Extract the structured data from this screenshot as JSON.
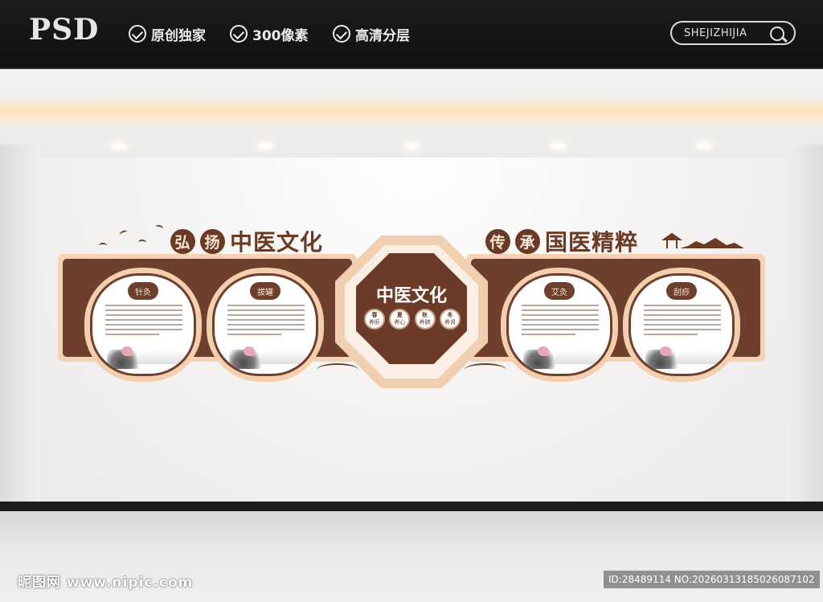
{
  "banner": {
    "logo": "PSD",
    "badges": [
      "原创独家",
      "300像素",
      "高清分层"
    ],
    "search_text": "SHEJIZHIJIA"
  },
  "mural": {
    "left_title": {
      "seals": [
        "弘",
        "扬"
      ],
      "text": "中医文化"
    },
    "right_title": {
      "seals": [
        "传",
        "承"
      ],
      "text": "国医精粹"
    },
    "center": {
      "title": "中医文化",
      "circles": [
        {
          "top": "春",
          "bottom": "养肝"
        },
        {
          "top": "夏",
          "bottom": "养心"
        },
        {
          "top": "秋",
          "bottom": "养肺"
        },
        {
          "top": "冬",
          "bottom": "养肾"
        }
      ]
    },
    "cards": [
      "针灸",
      "拔罐",
      "艾灸",
      "刮痧"
    ]
  },
  "watermark": {
    "left": "昵图网 www.nipic.com",
    "right": "ID:28489114 NO:20260313185026087102"
  },
  "colors": {
    "brown": "#6d3f2c",
    "peach": "#f3cfae",
    "banner": "#151515"
  }
}
